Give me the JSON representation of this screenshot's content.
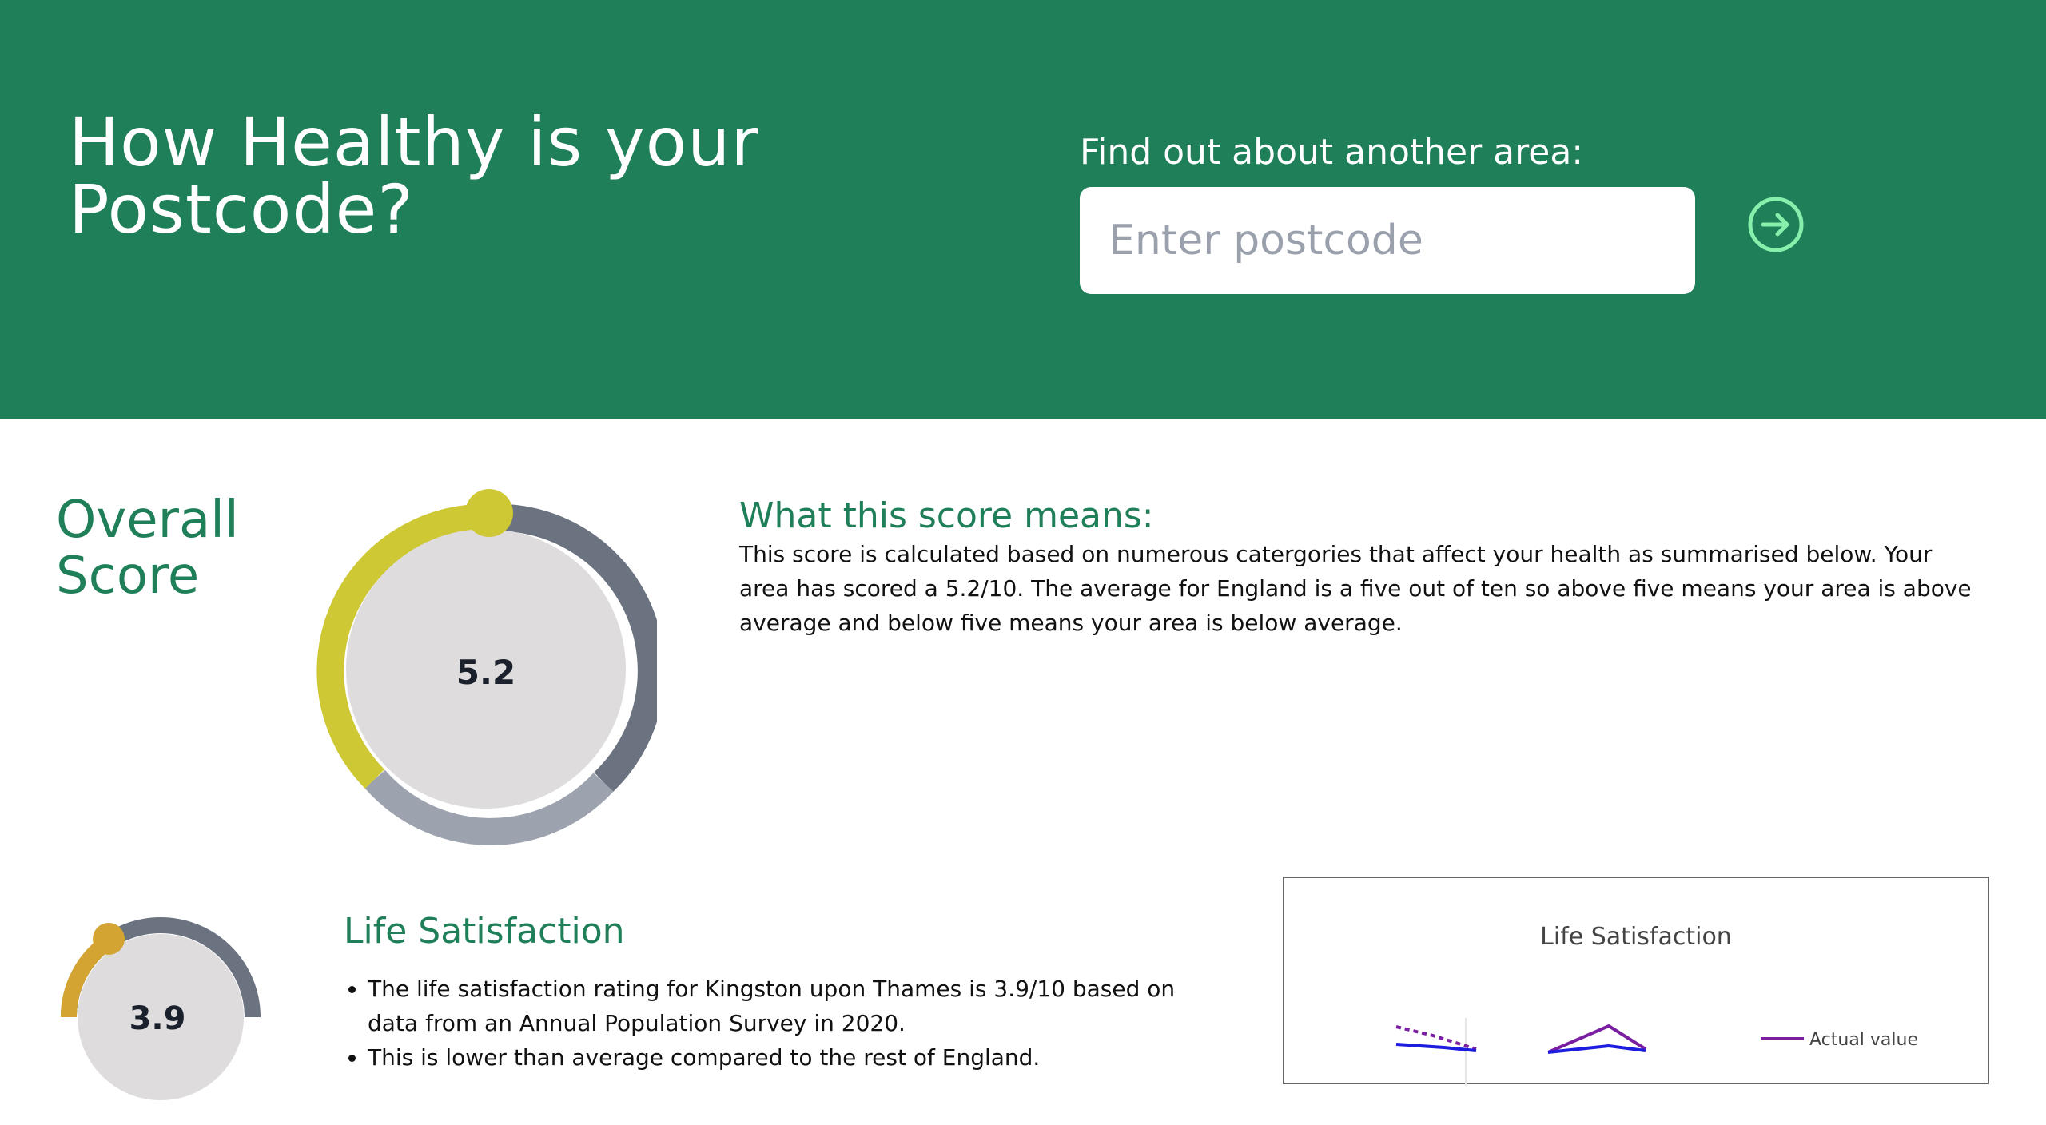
{
  "header": {
    "title": "How Healthy is your Postcode?",
    "search_label": "Find out about another area:",
    "postcode_placeholder": "Enter postcode",
    "postcode_value": "",
    "go_icon": "arrow-right-circle-icon"
  },
  "overall": {
    "heading": "Overall Score",
    "score": 5.2,
    "score_label": "5.2",
    "max": 10,
    "meaning_heading": "What this score means:",
    "meaning_text": "This score is calculated based on numerous catergories that affect your health as summarised below. Your area has scored a 5.2/10. The average for England is a five out of ten so above five means your area is above average and below five means your area is below average."
  },
  "life_satisfaction": {
    "heading": "Life Satisfaction",
    "score": 3.9,
    "score_label": "3.9",
    "max": 10,
    "bullets": [
      "The life satisfaction rating for Kingston upon Thames is 3.9/10 based on data from an Annual Population Survey in 2020.",
      "This is lower than average compared to the rest of England."
    ]
  },
  "chart_data": {
    "type": "line",
    "title": "Life Satisfaction",
    "series": [
      {
        "name": "Actual value",
        "color": "#7b1fa2"
      }
    ]
  },
  "colors": {
    "header_bg": "#1f7f58",
    "heading_green": "#1f7f58",
    "go_icon": "#86efac",
    "gauge_overall": "#cdc833",
    "gauge_life": "#d4a432",
    "gauge_track_dark": "#6b7280",
    "gauge_track_light": "#9ca3af",
    "gauge_fill": "#dedcdc"
  }
}
